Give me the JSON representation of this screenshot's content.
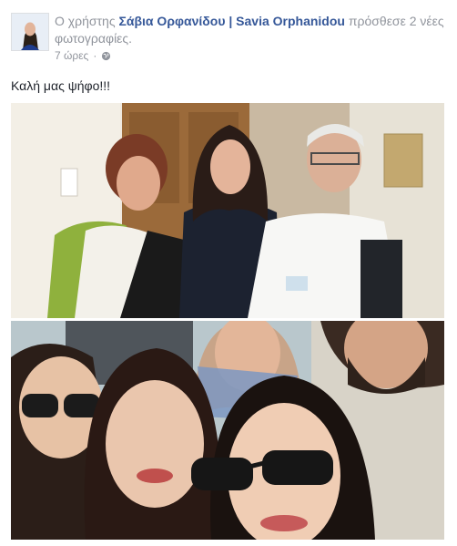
{
  "post": {
    "header": {
      "prefix": "Ο χρήστης",
      "author": "Σάβια Ορφανίδου | Savia Orphanidou",
      "action": "πρόσθεσε 2 νέες φωτογραφίες."
    },
    "timestamp": "7 ώρες",
    "separator": "·",
    "privacy_icon": "globe-icon",
    "text": "Καλή μας ψήφο!!!",
    "photos": [
      {
        "alt": "photo-1"
      },
      {
        "alt": "photo-2"
      }
    ]
  },
  "colors": {
    "link": "#365899",
    "meta": "#90949c",
    "text": "#1d2129"
  }
}
